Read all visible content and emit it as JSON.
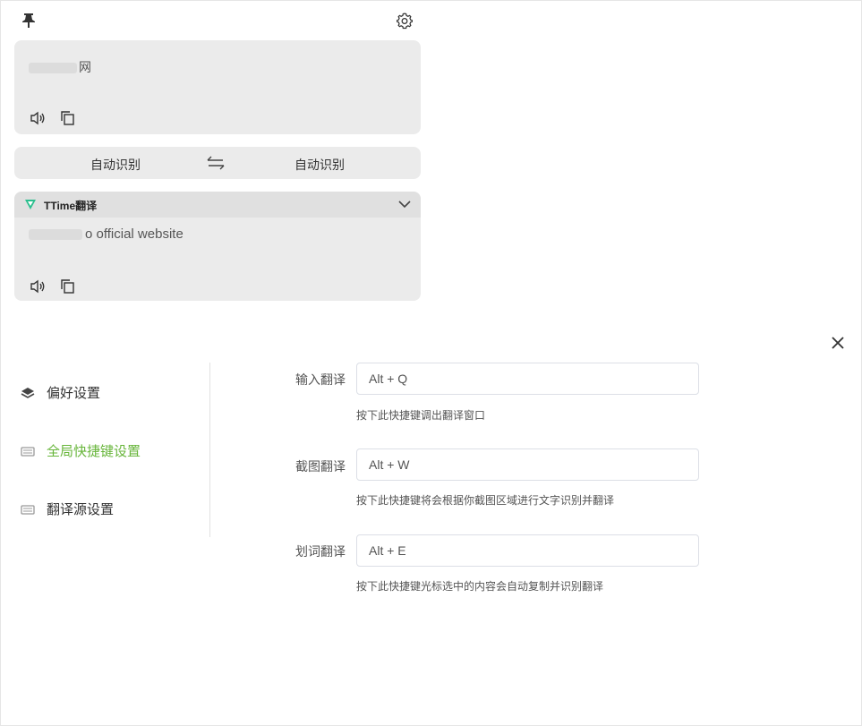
{
  "translator": {
    "source_text": "网",
    "source_lang": "自动识别",
    "target_lang": "自动识别",
    "engine_name": "TTime翻译",
    "result_text": "o official website"
  },
  "settings": {
    "nav": [
      {
        "label": "偏好设置",
        "icon": "layers-icon"
      },
      {
        "label": "全局快捷键设置",
        "icon": "keyboard-icon",
        "active": true
      },
      {
        "label": "翻译源设置",
        "icon": "keyboard-icon"
      }
    ],
    "shortcuts": [
      {
        "label": "输入翻译",
        "value": "Alt + Q",
        "hint": "按下此快捷键调出翻译窗口"
      },
      {
        "label": "截图翻译",
        "value": "Alt + W",
        "hint": "按下此快捷键将会根据你截图区域进行文字识别并翻译"
      },
      {
        "label": "划词翻译",
        "value": "Alt + E",
        "hint": "按下此快捷键光标选中的内容会自动复制并识别翻译"
      }
    ]
  },
  "colors": {
    "accent": "#67b53a",
    "card_bg": "#ebebeb",
    "engine_logo": "#2bbf8e"
  }
}
